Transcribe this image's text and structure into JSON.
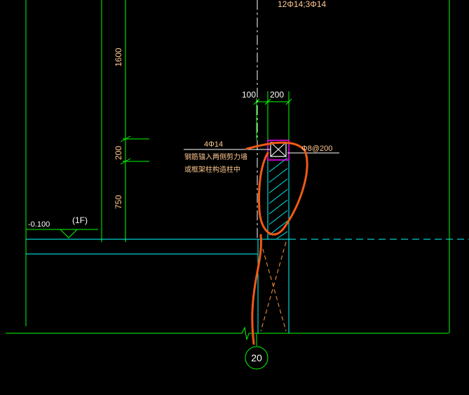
{
  "colors": {
    "background": "#000000",
    "green": "#00ff00",
    "cyan": "#00ffff",
    "orange": "#ff8c3a",
    "text": "#ffc890",
    "magenta": "#ff00ff",
    "white": "#ffffff",
    "annotation": "#f05a14",
    "dash": "#ffffff"
  },
  "drawing": {
    "top_rebar_note": "12Φ14;3Φ14",
    "dim_1600": "1600",
    "dim_200_vertical": "200",
    "dim_750": "750",
    "dim_100": "100",
    "dim_200_horizontal": "200",
    "rebar_label": "4Φ14",
    "anchor_note_line1": "钢筋锚入两侧剪力墙",
    "anchor_note_line2": "或框架柱构造柱中",
    "stirrup_label": "Φ8@200",
    "level_value": "-0.100",
    "floor_tag": "(1F)",
    "axis_number": "20"
  }
}
